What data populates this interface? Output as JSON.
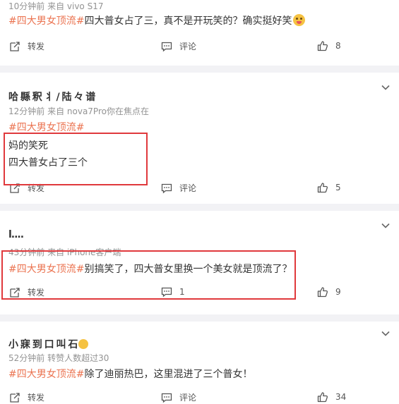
{
  "posts": [
    {
      "meta": "10分钟前  来自 vivo S17",
      "hashtag": "#四大男女顶流#",
      "text": "四大普女占了三，真不是开玩笑的？确实挺好笑",
      "actions": {
        "forward": "转发",
        "comment": "评论",
        "like": "8"
      }
    },
    {
      "username": "哈 縣 釈 丬 / 陆 々 谱",
      "meta": "12分钟前  来自 nova7Pro你在焦点在",
      "hashtag": "#四大男女顶流#",
      "line1": "妈的笑死",
      "line2": "四大普女占了三个",
      "actions": {
        "forward": "转发",
        "comment": "评论",
        "like": "5"
      }
    },
    {
      "username": "l....",
      "meta": "43分钟前  来自 iPhone客户端",
      "hashtag": "#四大男女顶流#",
      "text": "别搞笑了，四大普女里换一个美女就是顶流了？",
      "actions": {
        "forward": "转发",
        "comment": "1",
        "like": "9"
      }
    },
    {
      "username": "小 寐 到 口 叫 石",
      "meta": "52分钟前  转赞人数超过30",
      "hashtag": "#四大男女顶流#",
      "text": "除了迪丽热巴，这里混进了三个普女！",
      "actions": {
        "forward": "转发",
        "comment": "评论",
        "like": "34"
      }
    }
  ],
  "colors": {
    "hashtag": "#eb7350",
    "highlight": "#e0393c",
    "separator": "#f2f2f5"
  }
}
